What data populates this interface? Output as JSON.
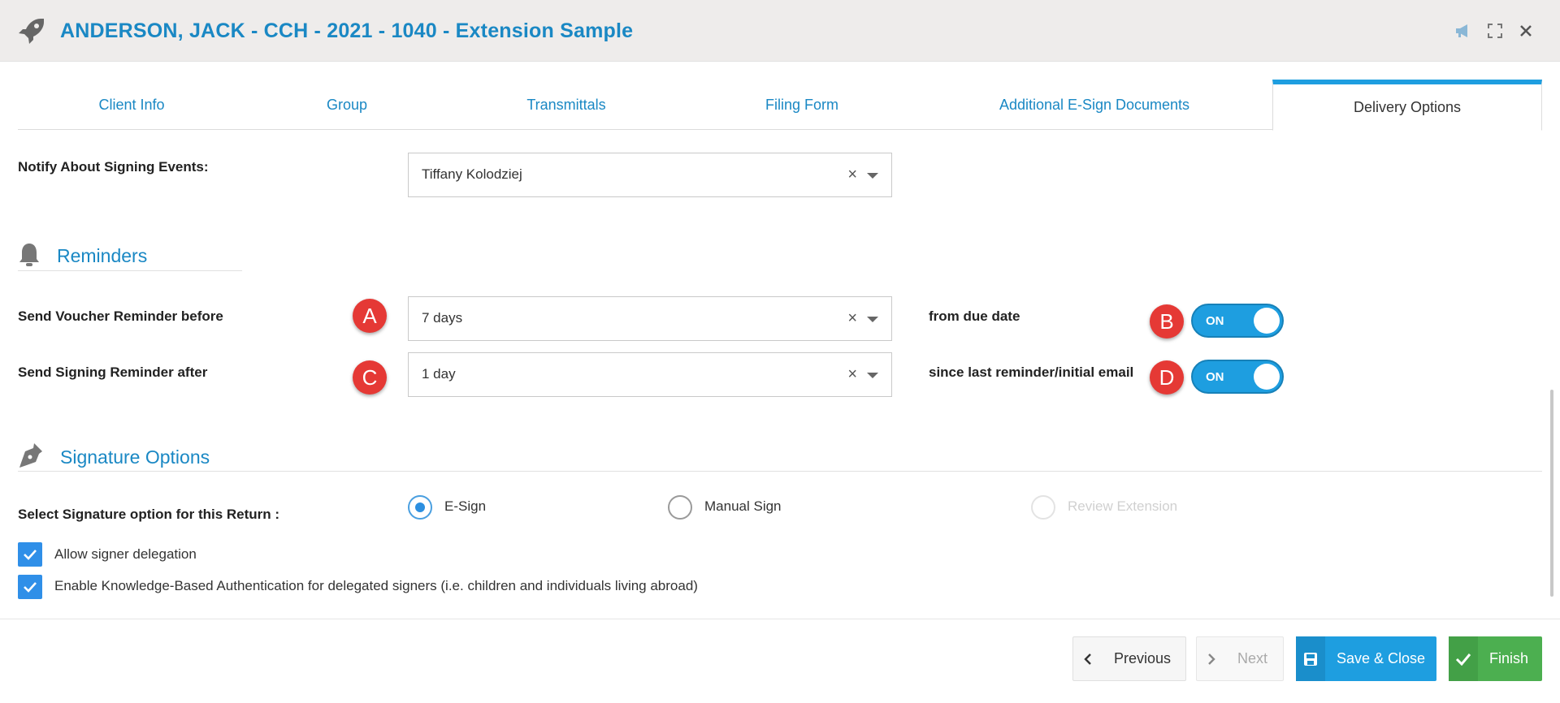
{
  "header": {
    "title": "ANDERSON, JACK - CCH - 2021 - 1040 - Extension Sample",
    "icons": [
      "rocket-icon",
      "megaphone-icon",
      "expand-icon",
      "close-icon"
    ]
  },
  "tabs": [
    {
      "label": "Client Info",
      "active": false
    },
    {
      "label": "Group",
      "active": false
    },
    {
      "label": "Transmittals",
      "active": false
    },
    {
      "label": "Filing Form",
      "active": false
    },
    {
      "label": "Additional E-Sign Documents",
      "active": false
    },
    {
      "label": "Delivery Options",
      "active": true
    }
  ],
  "notify": {
    "label": "Notify About Signing Events:",
    "value": "Tiffany Kolodziej"
  },
  "reminders": {
    "title": "Reminders",
    "voucher": {
      "label": "Send Voucher Reminder before",
      "value": "7 days",
      "suffix": "from due date",
      "badge": "A",
      "toggle_badge": "B",
      "toggle": "ON"
    },
    "signing": {
      "label": "Send Signing Reminder after",
      "value": "1 day",
      "suffix": "since last reminder/initial email",
      "badge": "C",
      "toggle_badge": "D",
      "toggle": "ON"
    }
  },
  "signature": {
    "title": "Signature Options",
    "select_label": "Select Signature option for this Return :",
    "options": [
      {
        "label": "E-Sign",
        "checked": true,
        "disabled": false
      },
      {
        "label": "Manual Sign",
        "checked": false,
        "disabled": false
      },
      {
        "label": "Review Extension",
        "checked": false,
        "disabled": true
      }
    ],
    "checkboxes": [
      {
        "label": "Allow signer delegation",
        "checked": true
      },
      {
        "label": "Enable Knowledge-Based Authentication for delegated signers (i.e. children and individuals living abroad)",
        "checked": true
      }
    ]
  },
  "footer": {
    "previous": "Previous",
    "next": "Next",
    "save_close": "Save & Close",
    "finish": "Finish"
  },
  "colors": {
    "accent": "#1a88c4",
    "toggle": "#1e9ee0",
    "badge": "#e53935",
    "finish": "#4caf50"
  }
}
